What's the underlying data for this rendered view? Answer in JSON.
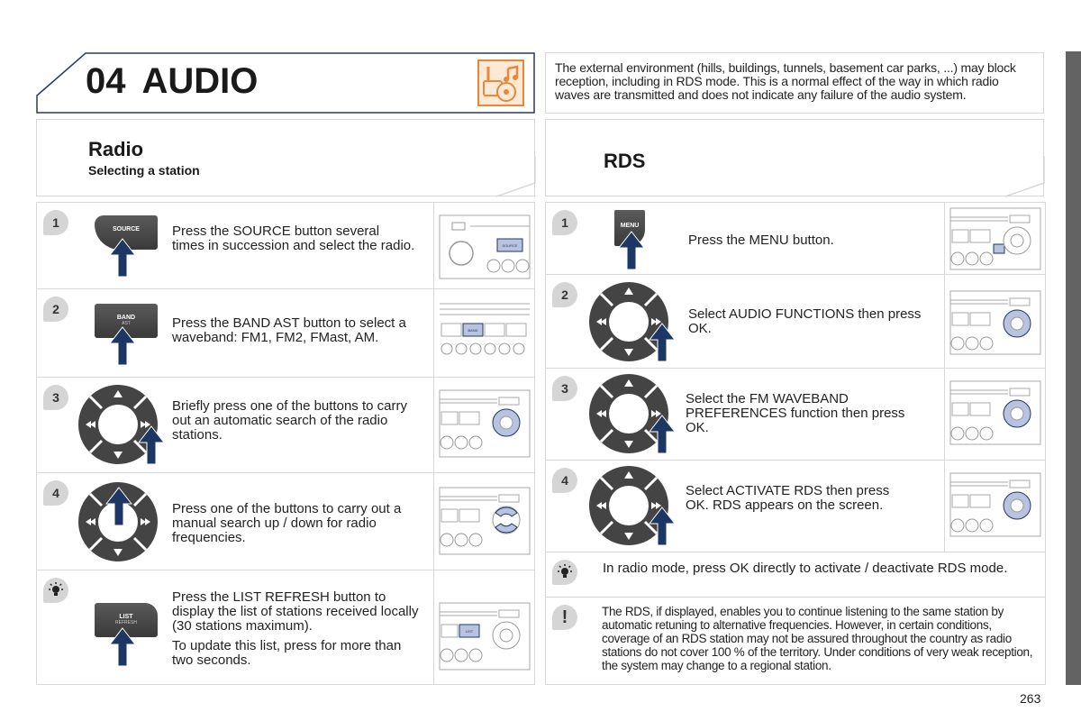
{
  "chapter": {
    "number": "04",
    "title": "AUDIO",
    "icon": "radio-music-cd-icon",
    "accent_color": "#e8883a"
  },
  "info_note": "The external environment (hills, buildings, tunnels, basement car parks, ...) may block reception, including in RDS mode. This is a normal effect of the way in which radio waves are transmitted and does not indicate any failure of the audio system.",
  "radio": {
    "title": "Radio",
    "subtitle": "Selecting a station",
    "steps": [
      {
        "badge": "1",
        "button": {
          "label": "SOURCE",
          "sublabel": ""
        },
        "text": "Press the SOURCE button several times in succession and select the radio."
      },
      {
        "badge": "2",
        "button": {
          "label": "BAND",
          "sublabel": "AST"
        },
        "text": "Press the BAND AST button to select a waveband: FM1, FM2, FMast, AM."
      },
      {
        "badge": "3",
        "control": "dpad-right",
        "text": "Briefly press one of the buttons to carry out an automatic search of the radio stations."
      },
      {
        "badge": "4",
        "control": "dpad-up",
        "text": "Press one of the buttons to carry out a manual search up / down for radio frequencies."
      },
      {
        "badge": "tip",
        "button": {
          "label": "LIST",
          "sublabel": "REFRESH"
        },
        "text": "Press the LIST REFRESH button to display the list of stations received locally (30 stations maximum).",
        "text2": "To update this list, press for more than two seconds."
      }
    ],
    "diagram_labels": {
      "source": "SOURCE",
      "band": "BAND",
      "list": "LIST"
    }
  },
  "rds": {
    "title": "RDS",
    "steps": [
      {
        "badge": "1",
        "button": {
          "label": "MENU"
        },
        "text": "Press the MENU button."
      },
      {
        "badge": "2",
        "control": "dpad-right",
        "text": "Select AUDIO FUNCTIONS then press OK."
      },
      {
        "badge": "3",
        "control": "dpad-right",
        "text": "Select the FM WAVEBAND PREFERENCES function then press OK."
      },
      {
        "badge": "4",
        "control": "dpad-right",
        "text": "Select ACTIVATE RDS then press OK. RDS appears on the screen."
      }
    ],
    "tip": "In radio mode, press OK directly to activate / deactivate RDS mode.",
    "warning": "The RDS, if displayed, enables you to continue listening to the same station by automatic retuning to alternative frequencies. However, in certain conditions, coverage of an RDS station may not be assured throughout the country as radio stations do not cover 100 % of the territory. Under conditions of very weak reception, the system may change to a regional station."
  },
  "colors": {
    "button_dark": "#3f3f3f",
    "arrow_blue": "#1c3763",
    "highlight_blue": "#b9c3e0",
    "badge_gray": "#d5d5d5",
    "side_tab": "#636363"
  },
  "page_number": "263"
}
